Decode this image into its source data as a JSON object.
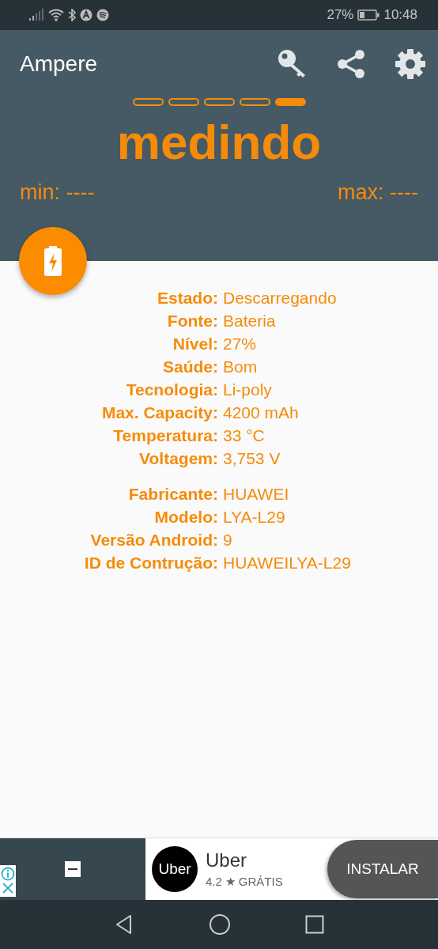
{
  "status_bar": {
    "battery_percent": "27%",
    "time": "10:48"
  },
  "app_bar": {
    "title": "Ampere"
  },
  "meter": {
    "segments": [
      {
        "selected": false
      },
      {
        "selected": false
      },
      {
        "selected": false
      },
      {
        "selected": false
      },
      {
        "selected": true
      }
    ],
    "reading": "medindo",
    "min": "min: ----",
    "max": "max: ----"
  },
  "sections": [
    {
      "rows": [
        {
          "label": "Estado:",
          "value": "Descarregando"
        },
        {
          "label": "Fonte:",
          "value": "Bateria"
        },
        {
          "label": "Nível:",
          "value": "27%"
        },
        {
          "label": "Saúde:",
          "value": "Bom"
        },
        {
          "label": "Tecnologia:",
          "value": "Li-poly"
        },
        {
          "label": "Max. Capacity:",
          "value": "4200 mAh"
        },
        {
          "label": "Temperatura:",
          "value": "33 °C"
        },
        {
          "label": "Voltagem:",
          "value": "3,753 V"
        }
      ]
    },
    {
      "rows": [
        {
          "label": "Fabricante:",
          "value": "HUAWEI"
        },
        {
          "label": "Modelo:",
          "value": "LYA-L29"
        },
        {
          "label": "Versão Android:",
          "value": "9"
        },
        {
          "label": "ID de Contrução:",
          "value": "HUAWEILYA-L29"
        }
      ]
    }
  ],
  "ad": {
    "logo_text": "Uber",
    "app_name": "Uber",
    "rating": "4.2",
    "star": "★",
    "price": "GRÁTIS",
    "button": "INSTALAR"
  }
}
